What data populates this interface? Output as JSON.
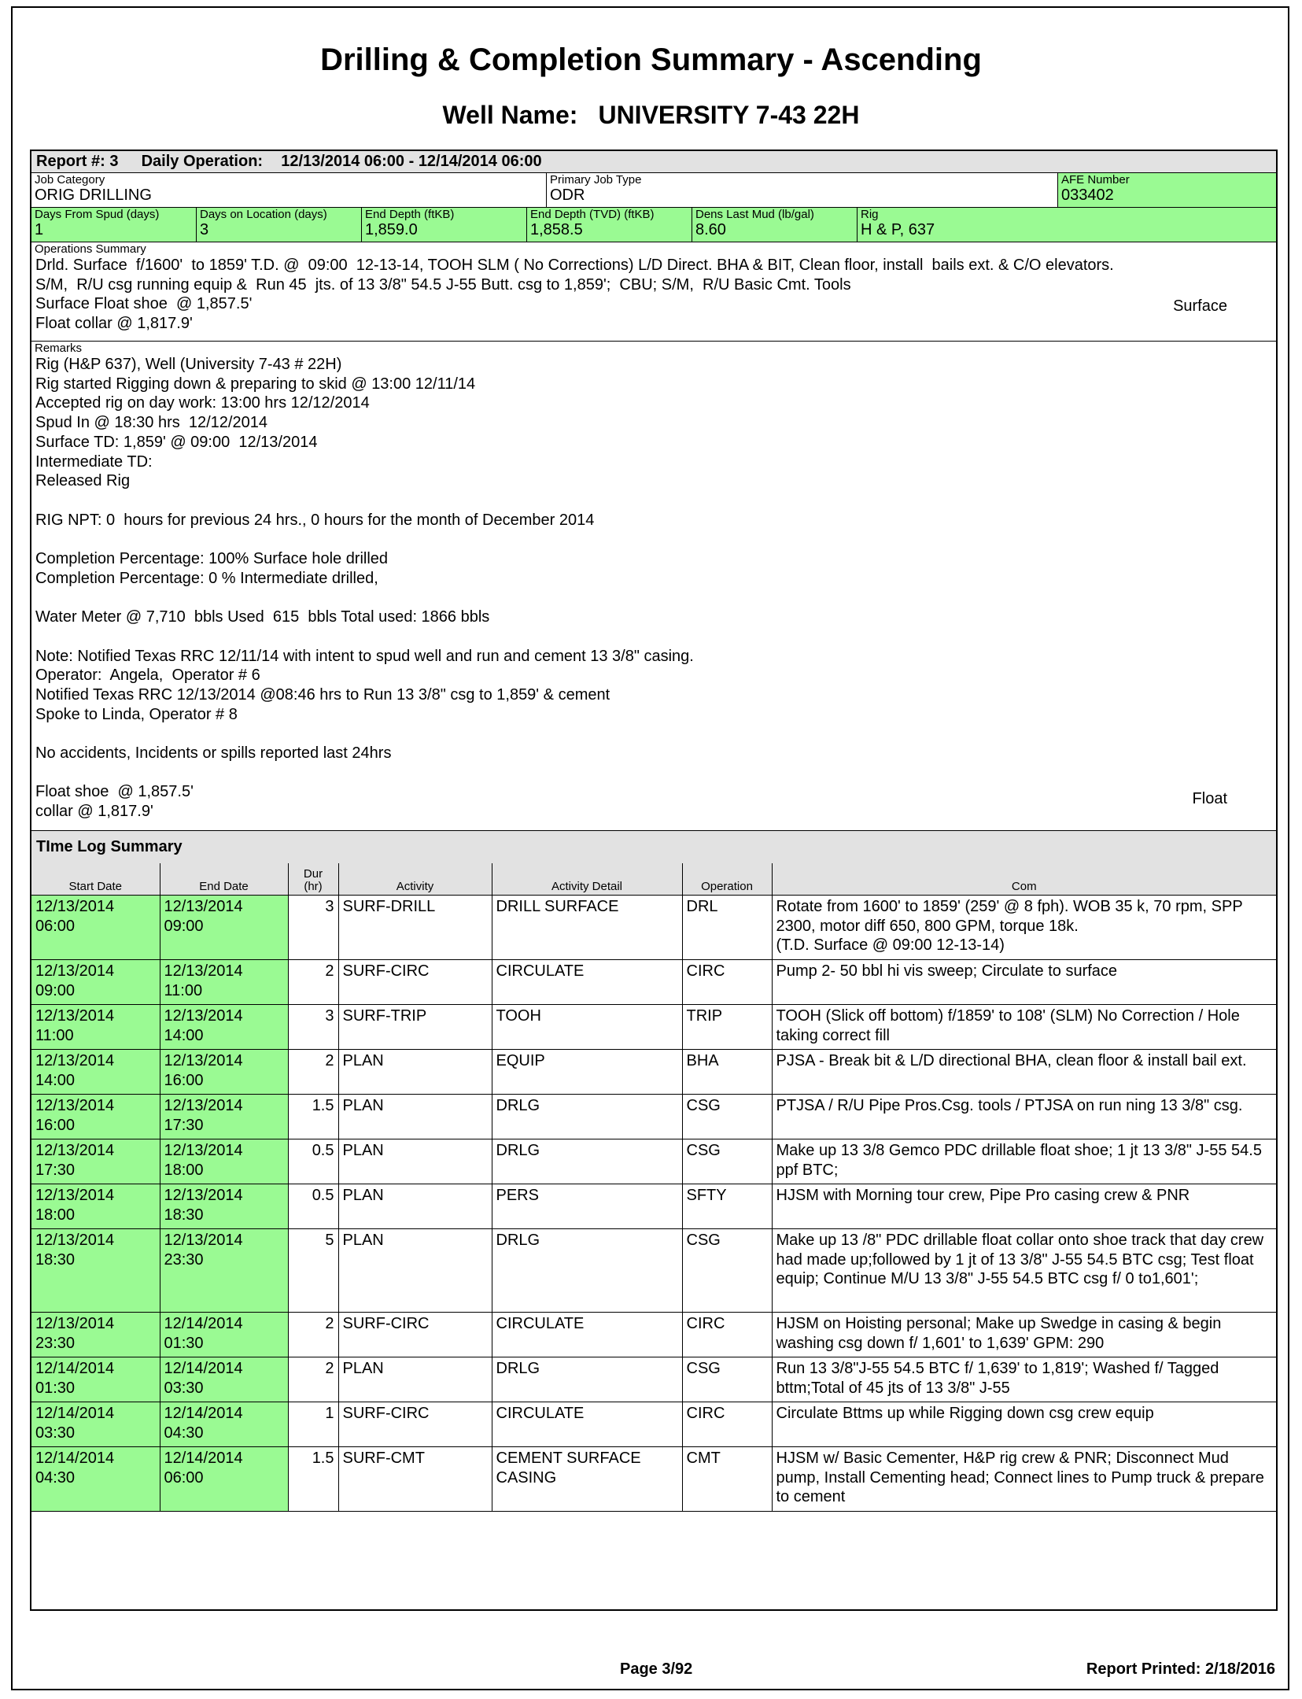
{
  "title": "Drilling & Completion Summary - Ascending",
  "well": {
    "label": "Well Name:",
    "value": "UNIVERSITY 7-43 22H"
  },
  "report": {
    "number_label": "Report #:",
    "number": "3",
    "daily_label": "Daily Operation:",
    "start": "12/13/2014 06:00",
    "end": "12/14/2014 06:00"
  },
  "job": {
    "category_label": "Job Category",
    "category": "ORIG DRILLING",
    "primary_label": "Primary Job Type",
    "primary": "ODR",
    "afe_label": "AFE Number",
    "afe": "033402"
  },
  "stats": {
    "spud_label": "Days From Spud (days)",
    "spud": "1",
    "loc_label": "Days on Location (days)",
    "loc": "3",
    "depth_label": "End Depth (ftKB)",
    "depth": "1,859.0",
    "tvd_label": "End Depth (TVD) (ftKB)",
    "tvd": "1,858.5",
    "mud_label": "Dens Last Mud (lb/gal)",
    "mud": "8.60",
    "rig_label": "Rig",
    "rig": "H & P, 637"
  },
  "ops": {
    "label": "Operations Summary",
    "text": "Drld. Surface  f/1600'  to 1859' T.D. @  09:00  12-13-14, TOOH SLM ( No Corrections) L/D Direct. BHA & BIT, Clean floor, install  bails ext. & C/O elevators.\nS/M,  R/U csg running equip &  Run 45  jts. of 13 3/8\" 54.5 J-55 Butt. csg to 1,859';  CBU; S/M,  R/U Basic Cmt. Tools\nSurface Float shoe  @ 1,857.5'\nFloat collar @ 1,817.9'",
    "right_word": "Surface"
  },
  "remarks": {
    "label": "Remarks",
    "text": "Rig (H&P 637), Well (University 7-43 # 22H)\nRig started Rigging down & preparing to skid @ 13:00 12/11/14\nAccepted rig on day work: 13:00 hrs 12/12/2014\nSpud In @ 18:30 hrs  12/12/2014\nSurface TD: 1,859' @ 09:00  12/13/2014\nIntermediate TD:\nReleased Rig\n\nRIG NPT: 0  hours for previous 24 hrs., 0 hours for the month of December 2014\n\nCompletion Percentage: 100% Surface hole drilled\nCompletion Percentage: 0 % Intermediate drilled,\n\nWater Meter @ 7,710  bbls Used  615  bbls Total used: 1866 bbls\n\nNote: Notified Texas RRC 12/11/14 with intent to spud well and run and cement 13 3/8\" casing.\nOperator:  Angela,  Operator # 6\nNotified Texas RRC 12/13/2014 @08:46 hrs to Run 13 3/8\" csg to 1,859' & cement\nSpoke to Linda, Operator # 8\n\nNo accidents, Incidents or spills reported last 24hrs\n\nFloat shoe  @ 1,857.5'\ncollar @ 1,817.9'",
    "right_word": "Float"
  },
  "timelog": {
    "title": "TIme Log Summary",
    "headers": [
      "Start Date",
      "End Date",
      "Dur\n(hr)",
      "Activity",
      "Activity Detail",
      "Operation",
      "Com"
    ],
    "rows": [
      [
        "12/13/2014\n06:00",
        "12/13/2014\n09:00",
        "3",
        "SURF-DRILL",
        "DRILL SURFACE",
        "DRL",
        "Rotate from 1600' to 1859' (259' @ 8 fph). WOB 35 k, 70 rpm, SPP 2300, motor diff 650, 800 GPM, torque 18k.\n(T.D. Surface @  09:00  12-13-14)"
      ],
      [
        "12/13/2014\n09:00",
        "12/13/2014\n11:00",
        "2",
        "SURF-CIRC",
        "CIRCULATE",
        "CIRC",
        "Pump 2- 50 bbl hi vis sweep; Circulate to surface"
      ],
      [
        "12/13/2014\n11:00",
        "12/13/2014\n14:00",
        "3",
        "SURF-TRIP",
        "TOOH",
        "TRIP",
        "TOOH (Slick off bottom)  f/1859' to 108' (SLM)  No Correction / Hole taking correct fill"
      ],
      [
        "12/13/2014\n14:00",
        "12/13/2014\n16:00",
        "2",
        "PLAN",
        "EQUIP",
        "BHA",
        "PJSA - Break bit & L/D directional BHA, clean floor & install bail ext."
      ],
      [
        "12/13/2014\n16:00",
        "12/13/2014\n17:30",
        "1.5",
        "PLAN",
        "DRLG",
        "CSG",
        "PTJSA / R/U Pipe Pros.Csg. tools / PTJSA on run ning 13 3/8\" csg."
      ],
      [
        "12/13/2014\n17:30",
        "12/13/2014\n18:00",
        "0.5",
        "PLAN",
        "DRLG",
        "CSG",
        "Make up 13 3/8 Gemco PDC drillable float shoe; 1 jt 13 3/8\" J-55  54.5 ppf BTC;"
      ],
      [
        "12/13/2014\n18:00",
        "12/13/2014\n18:30",
        "0.5",
        "PLAN",
        "PERS",
        "SFTY",
        "HJSM with Morning tour crew, Pipe Pro casing crew & PNR"
      ],
      [
        "12/13/2014\n18:30",
        "12/13/2014\n23:30",
        "5",
        "PLAN",
        "DRLG",
        "CSG",
        "Make up 13 /8\" PDC drillable float collar onto shoe track that day crew had made up;followed by 1 jt of 13 3/8\" J-55 54.5 BTC csg; Test float equip; Continue M/U 13 3/8\" J-55 54.5 BTC csg f/ 0  to1,601';"
      ],
      [
        "12/13/2014\n23:30",
        "12/14/2014\n01:30",
        "2",
        "SURF-CIRC",
        "CIRCULATE",
        "CIRC",
        "HJSM on Hoisting personal; Make up Swedge in  casing & begin washing csg down f/ 1,601' to 1,639'  GPM: 290"
      ],
      [
        "12/14/2014\n01:30",
        "12/14/2014\n03:30",
        "2",
        "PLAN",
        "DRLG",
        "CSG",
        "Run 13 3/8\"J-55 54.5 BTC  f/ 1,639' to 1,819'; Washed f/ Tagged bttm;Total of 45 jts of 13 3/8\" J-55"
      ],
      [
        "12/14/2014\n03:30",
        "12/14/2014\n04:30",
        "1",
        "SURF-CIRC",
        "CIRCULATE",
        "CIRC",
        "Circulate Bttms up while Rigging down csg crew equip"
      ],
      [
        "12/14/2014\n04:30",
        "12/14/2014\n06:00",
        "1.5",
        "SURF-CMT",
        "CEMENT SURFACE CASING",
        "CMT",
        "HJSM w/ Basic Cementer, H&P rig crew & PNR;  Disconnect Mud pump, Install Cementing head; Connect lines to Pump truck & prepare to cement"
      ]
    ]
  },
  "footer": {
    "page": "Page  3/92",
    "printed": "Report Printed:   2/18/2016"
  },
  "colors": {
    "green": "#9afa93",
    "gray": "#e2e2e2"
  }
}
